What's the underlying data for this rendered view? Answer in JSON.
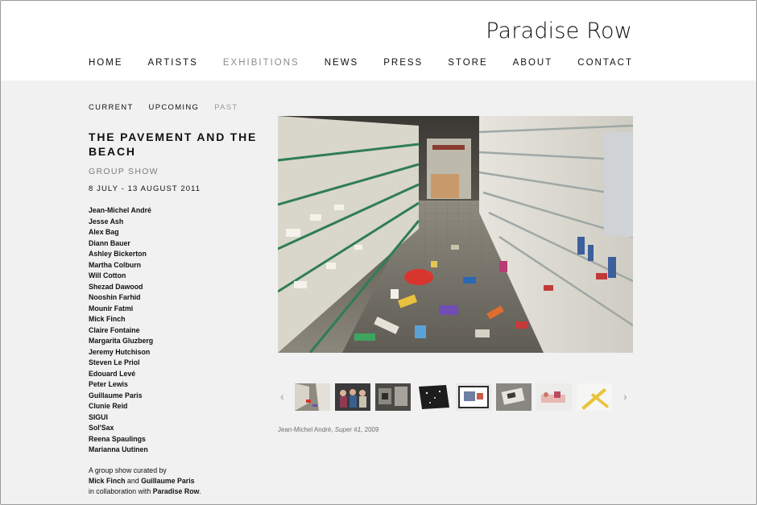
{
  "brand": "Paradise Row",
  "nav": [
    "HOME",
    "ARTISTS",
    "EXHIBITIONS",
    "NEWS",
    "PRESS",
    "STORE",
    "ABOUT",
    "CONTACT"
  ],
  "subnav": [
    "CURRENT",
    "UPCOMING",
    "PAST"
  ],
  "exhibition": {
    "title": "THE PAVEMENT AND THE BEACH",
    "subtitle": "GROUP SHOW",
    "dates": "8 JULY - 13 AUGUST 2011"
  },
  "artists": [
    "Jean-Michel André",
    "Jesse Ash",
    "Alex Bag",
    "Diann Bauer",
    "Ashley Bickerton",
    "Martha Colburn",
    "Will Cotton",
    "Shezad Dawood",
    "Nooshin Farhid",
    "Mounir Fatmi",
    "Mick Finch",
    "Claire Fontaine",
    "Margarita Gluzberg",
    "Jeremy Hutchison",
    "Steven Le Priol",
    "Edouard Levé",
    "Peter Lewis",
    "Guillaume Paris",
    "Clunie Reid",
    "SIGUI",
    "Sol'Sax",
    "Reena Spaulings",
    "Marianna Uutinen"
  ],
  "credits": {
    "line1": "A group show curated by",
    "name1": "Mick Finch",
    "and": "and",
    "name2": "Guillaume Paris",
    "line3_pre": "in collaboration with",
    "name3": "Paradise Row",
    "line3_post": "."
  },
  "caption": {
    "artist": "Jean-Michel André, ",
    "work": "Super #1",
    "year": ", 2009"
  },
  "gallery": {
    "prev_icon": "chevron-left-icon",
    "next_icon": "chevron-right-icon",
    "prev_glyph": "‹",
    "next_glyph": "›"
  },
  "colors": {
    "active_nav": "#8d8d8d",
    "background": "#f1f1f1",
    "header_bg": "#ffffff"
  }
}
